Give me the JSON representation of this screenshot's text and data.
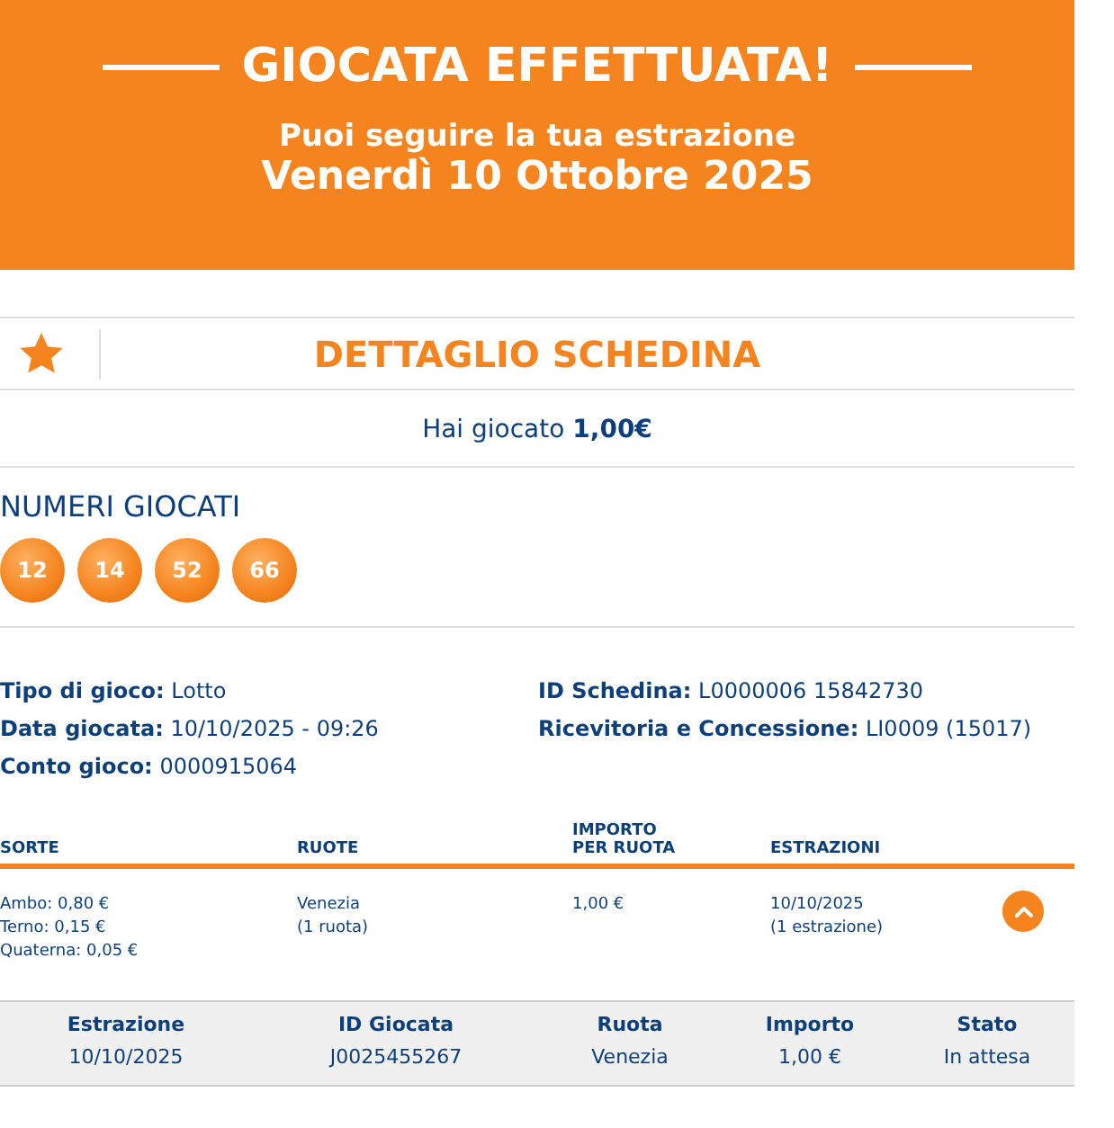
{
  "banner": {
    "title": "GIOCATA EFFETTUATA!",
    "subtitle": "Puoi seguire la tua estrazione",
    "date": "Venerdì 10 Ottobre 2025"
  },
  "detail": {
    "title": "DETTAGLIO SCHEDINA",
    "played": "Hai giocato **1,00€**"
  },
  "numbers": {
    "title": "NUMERI GIOCATI",
    "balls": [
      "12",
      "14",
      "52",
      "66"
    ]
  },
  "info_left": [
    {
      "label": "Tipo di gioco:",
      "value": "Lotto"
    },
    {
      "label": "Data giocata:",
      "value": "10/10/2025 - 09:26"
    },
    {
      "label": "Conto gioco:",
      "value": "0000915064"
    }
  ],
  "info_right": [
    {
      "label": "ID Schedina:",
      "value": "L0000006 15842730"
    },
    {
      "label": "Ricevitoria e Concessione:",
      "value": "LI0009 (15017)"
    }
  ],
  "bets": {
    "columns": [
      "SORTE",
      "RUOTE",
      "IMPORTO PER RUOTA",
      "ESTRAZIONI"
    ],
    "rows": [
      {
        "expanded": true,
        "cells": [
          [
            "Ambo: 0,80 €",
            "Terno: 0,15 €",
            "Quaterna: 0,05 €"
          ],
          [
            "Venezia",
            "(1 ruota)"
          ],
          [
            "1,00 €"
          ],
          [
            "10/10/2025",
            "(1 estrazione)"
          ]
        ]
      }
    ]
  },
  "draws": {
    "columns": [
      "Estrazione",
      "ID Giocata",
      "Ruota",
      "Importo",
      "Stato"
    ],
    "rows": [
      [
        "10/10/2025",
        "J0025455267",
        "Venezia",
        "1,00 €",
        "In attesa"
      ]
    ]
  }
}
